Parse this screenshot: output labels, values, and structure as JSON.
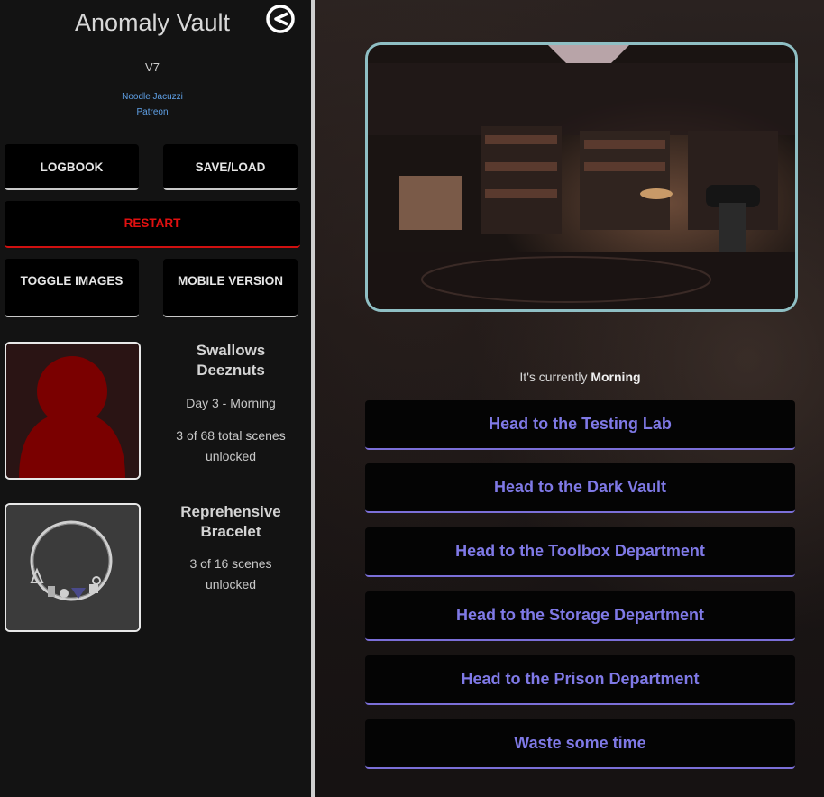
{
  "sidebar": {
    "title": "Anomaly Vault",
    "version": "V7",
    "links": [
      "Noodle Jacuzzi",
      "Patreon"
    ],
    "buttons": {
      "logbook": "LOGBOOK",
      "save_load": "SAVE/LOAD",
      "restart": "RESTART",
      "toggle_images": "TOGGLE IMAGES",
      "mobile_version": "MOBILE VERSION"
    },
    "character": {
      "name": "Swallows Deeznuts",
      "day": "Day 3 - Morning",
      "scenes": "3 of 68 total scenes unlocked"
    },
    "item": {
      "name": "Reprehensive Bracelet",
      "scenes": "3 of 16 scenes unlocked"
    }
  },
  "main": {
    "time_prefix": "It's currently",
    "time_value": "Morning",
    "actions": [
      "Head to the Testing Lab",
      "Head to the Dark Vault",
      "Head to the Toolbox Department",
      "Head to the Storage Department",
      "Head to the Prison Department",
      "Waste some time"
    ]
  },
  "colors": {
    "accent_link": "#5fa0e6",
    "restart_red": "#e01010",
    "action_text": "#7f79e6",
    "scene_border": "#8fbfc4",
    "avatar_red": "#7a0000"
  },
  "icons": {
    "back": "back-arrow-circle-icon"
  }
}
